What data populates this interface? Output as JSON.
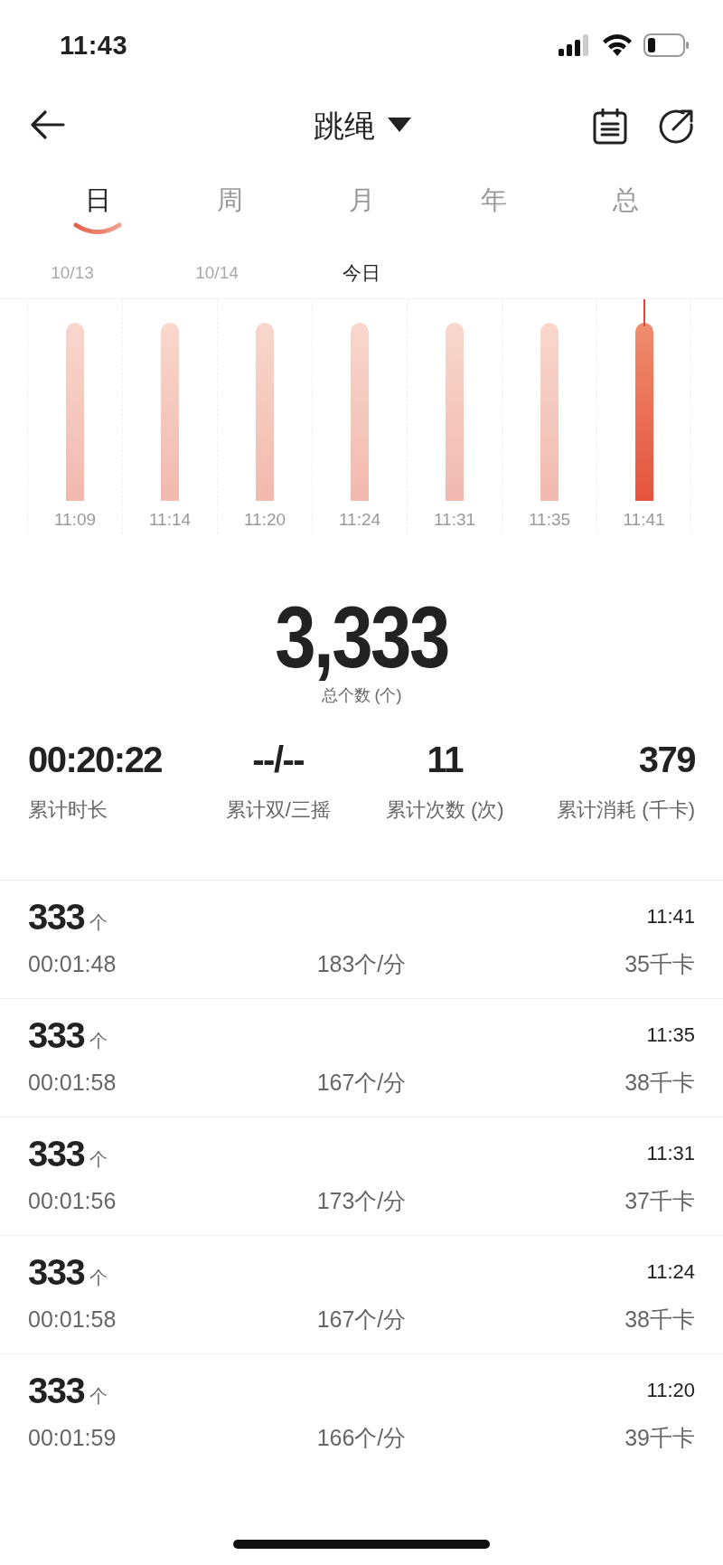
{
  "status_bar": {
    "time": "11:43"
  },
  "nav": {
    "title": "跳绳"
  },
  "period_tabs": [
    {
      "label": "日",
      "selected": true
    },
    {
      "label": "周",
      "selected": false
    },
    {
      "label": "月",
      "selected": false
    },
    {
      "label": "年",
      "selected": false
    },
    {
      "label": "总",
      "selected": false
    }
  ],
  "dates": [
    {
      "label": "10/13",
      "selected": false
    },
    {
      "label": "10/14",
      "selected": false
    },
    {
      "label": "今日",
      "selected": true
    }
  ],
  "chart_bars": [
    {
      "time": "11:09",
      "selected": false
    },
    {
      "time": "11:14",
      "selected": false
    },
    {
      "time": "11:20",
      "selected": false
    },
    {
      "time": "11:24",
      "selected": false
    },
    {
      "time": "11:31",
      "selected": false
    },
    {
      "time": "11:35",
      "selected": false
    },
    {
      "time": "11:41",
      "selected": true
    }
  ],
  "total": {
    "value": "3,333",
    "label": "总个数 (个)"
  },
  "stats": [
    {
      "value": "00:20:22",
      "label": "累计时长"
    },
    {
      "value": "--/--",
      "label": "累计双/三摇"
    },
    {
      "value": "11",
      "label": "累计次数 (次)"
    },
    {
      "value": "379",
      "label": "累计消耗 (千卡)"
    }
  ],
  "records": [
    {
      "count": "333",
      "unit": "个",
      "time": "11:41",
      "duration": "00:01:48",
      "rate": "183个/分",
      "calories": "35千卡"
    },
    {
      "count": "333",
      "unit": "个",
      "time": "11:35",
      "duration": "00:01:58",
      "rate": "167个/分",
      "calories": "38千卡"
    },
    {
      "count": "333",
      "unit": "个",
      "time": "11:31",
      "duration": "00:01:56",
      "rate": "173个/分",
      "calories": "37千卡"
    },
    {
      "count": "333",
      "unit": "个",
      "time": "11:24",
      "duration": "00:01:58",
      "rate": "167个/分",
      "calories": "38千卡"
    },
    {
      "count": "333",
      "unit": "个",
      "time": "11:20",
      "duration": "00:01:59",
      "rate": "166个/分",
      "calories": "39千卡"
    }
  ]
}
